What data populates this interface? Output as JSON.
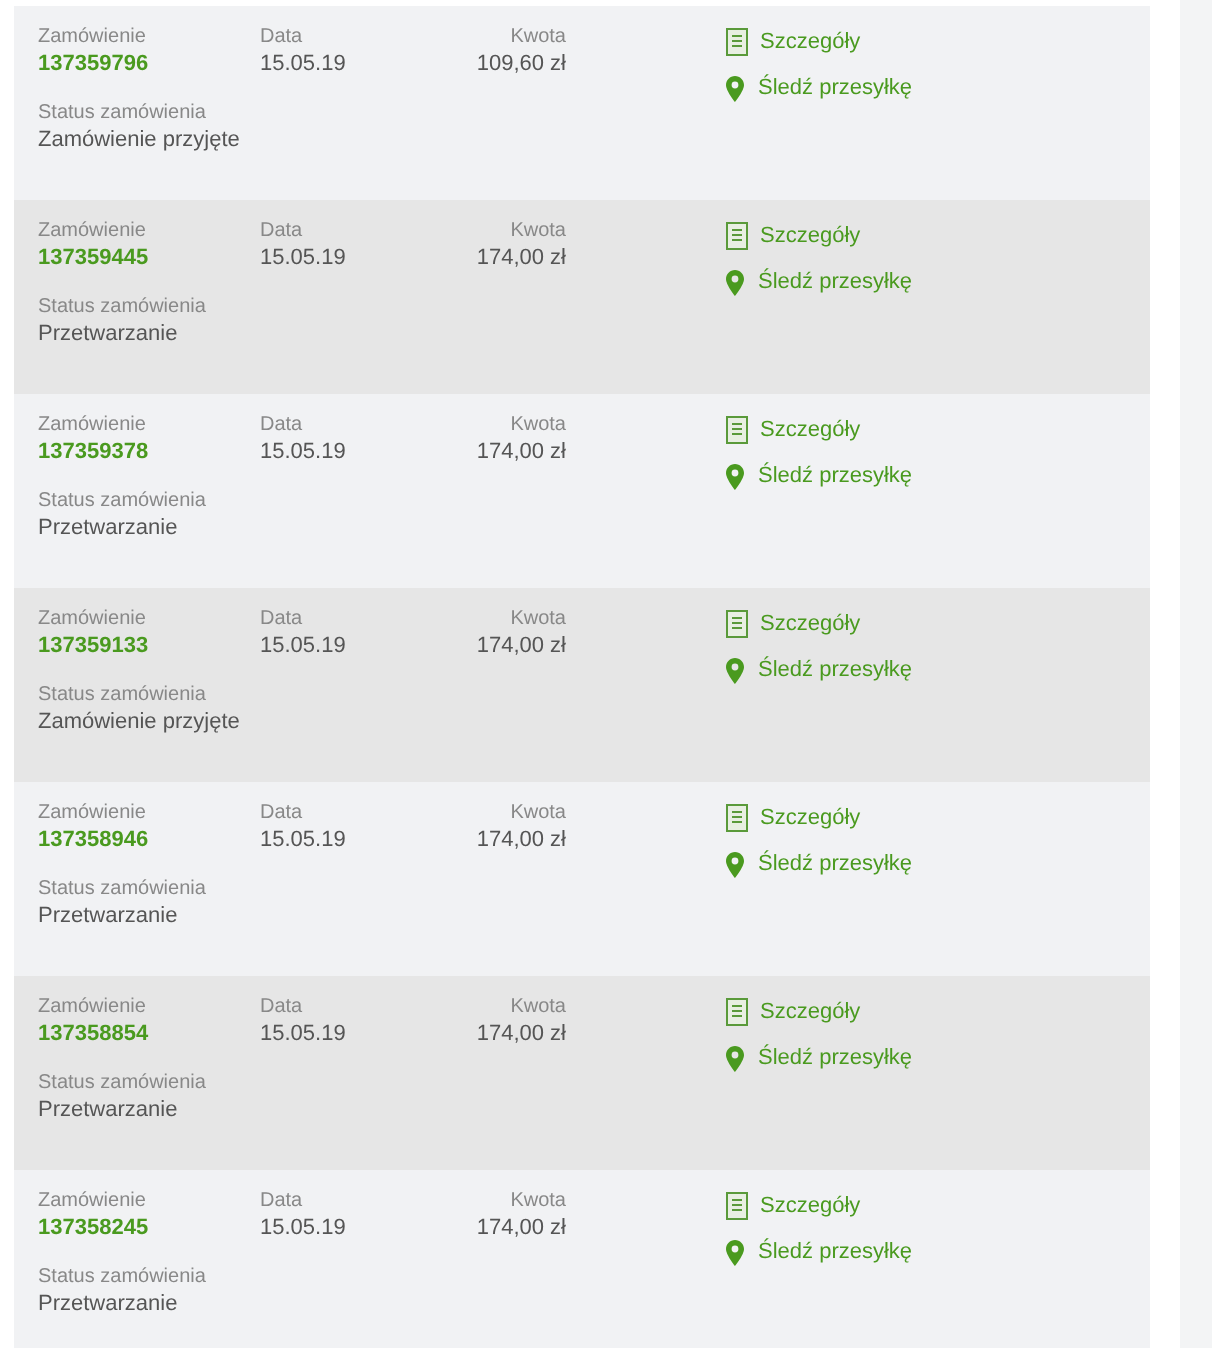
{
  "orders": [
    {
      "order_label": "Zamówienie",
      "number": "137359796",
      "date_label": "Data",
      "date": "15.05.19",
      "amount_label": "Kwota",
      "amount": "109,60 zł",
      "status_label": "Status zamówienia",
      "status": "Zamówienie przyjęte",
      "details_link": "Szczegóły",
      "track_link": "Śledź przesyłkę"
    },
    {
      "order_label": "Zamówienie",
      "number": "137359445",
      "date_label": "Data",
      "date": "15.05.19",
      "amount_label": "Kwota",
      "amount": "174,00 zł",
      "status_label": "Status zamówienia",
      "status": "Przetwarzanie",
      "details_link": "Szczegóły",
      "track_link": "Śledź przesyłkę"
    },
    {
      "order_label": "Zamówienie",
      "number": "137359378",
      "date_label": "Data",
      "date": "15.05.19",
      "amount_label": "Kwota",
      "amount": "174,00 zł",
      "status_label": "Status zamówienia",
      "status": "Przetwarzanie",
      "details_link": "Szczegóły",
      "track_link": "Śledź przesyłkę"
    },
    {
      "order_label": "Zamówienie",
      "number": "137359133",
      "date_label": "Data",
      "date": "15.05.19",
      "amount_label": "Kwota",
      "amount": "174,00 zł",
      "status_label": "Status zamówienia",
      "status": "Zamówienie przyjęte",
      "details_link": "Szczegóły",
      "track_link": "Śledź przesyłkę"
    },
    {
      "order_label": "Zamówienie",
      "number": "137358946",
      "date_label": "Data",
      "date": "15.05.19",
      "amount_label": "Kwota",
      "amount": "174,00 zł",
      "status_label": "Status zamówienia",
      "status": "Przetwarzanie",
      "details_link": "Szczegóły",
      "track_link": "Śledź przesyłkę"
    },
    {
      "order_label": "Zamówienie",
      "number": "137358854",
      "date_label": "Data",
      "date": "15.05.19",
      "amount_label": "Kwota",
      "amount": "174,00 zł",
      "status_label": "Status zamówienia",
      "status": "Przetwarzanie",
      "details_link": "Szczegóły",
      "track_link": "Śledź przesyłkę"
    },
    {
      "order_label": "Zamówienie",
      "number": "137358245",
      "date_label": "Data",
      "date": "15.05.19",
      "amount_label": "Kwota",
      "amount": "174,00 zł",
      "status_label": "Status zamówienia",
      "status": "Przetwarzanie",
      "details_link": "Szczegóły",
      "track_link": "Śledź przesyłkę"
    }
  ]
}
